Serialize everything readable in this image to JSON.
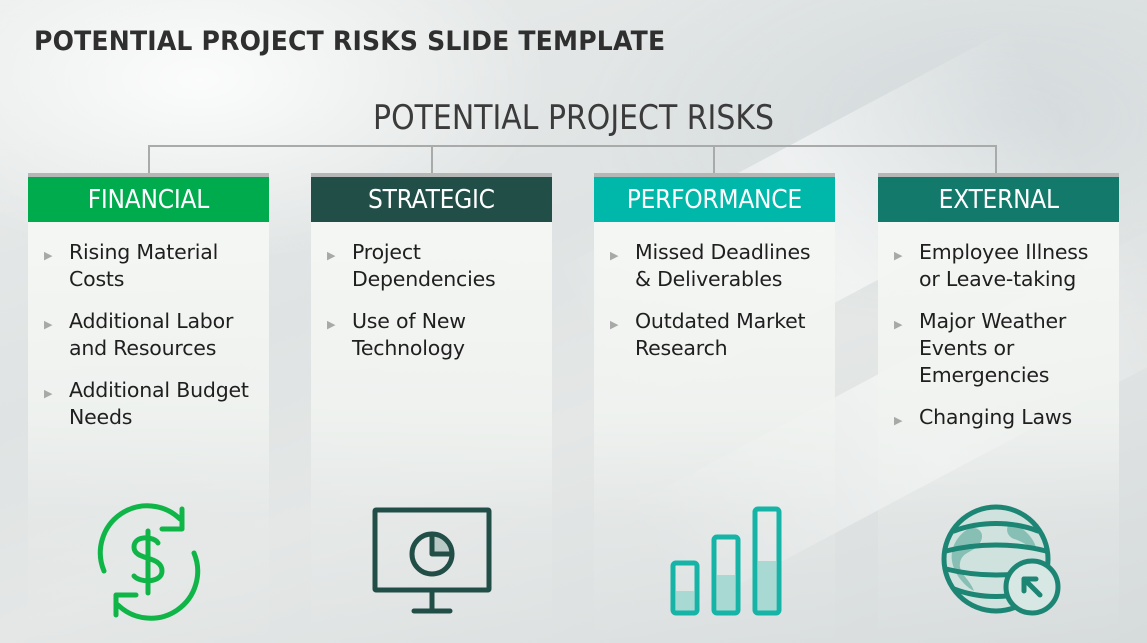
{
  "page_title": "POTENTIAL PROJECT RISKS SLIDE TEMPLATE",
  "slide": {
    "heading": "POTENTIAL PROJECT RISKS",
    "columns": [
      {
        "title": "FINANCIAL",
        "color": "#00ab4e",
        "icon": "dollar-refresh-icon",
        "items": [
          "Rising Material Costs",
          "Additional Labor and Resources",
          "Additional Budget Needs"
        ]
      },
      {
        "title": "STRATEGIC",
        "color": "#214f48",
        "icon": "monitor-pie-chart-icon",
        "items": [
          "Project Dependencies",
          "Use of New Technology"
        ]
      },
      {
        "title": "PERFORMANCE",
        "color": "#00b8a9",
        "icon": "bar-chart-icon",
        "items": [
          "Missed Deadlines & Deliverables",
          "Outdated Market Research"
        ]
      },
      {
        "title": "EXTERNAL",
        "color": "#137a6b",
        "icon": "globe-arrow-icon",
        "items": [
          "Employee Illness or Leave-taking",
          "Major Weather Events or Emergencies",
          "Changing Laws"
        ]
      }
    ],
    "bullet_glyph": "▶"
  }
}
